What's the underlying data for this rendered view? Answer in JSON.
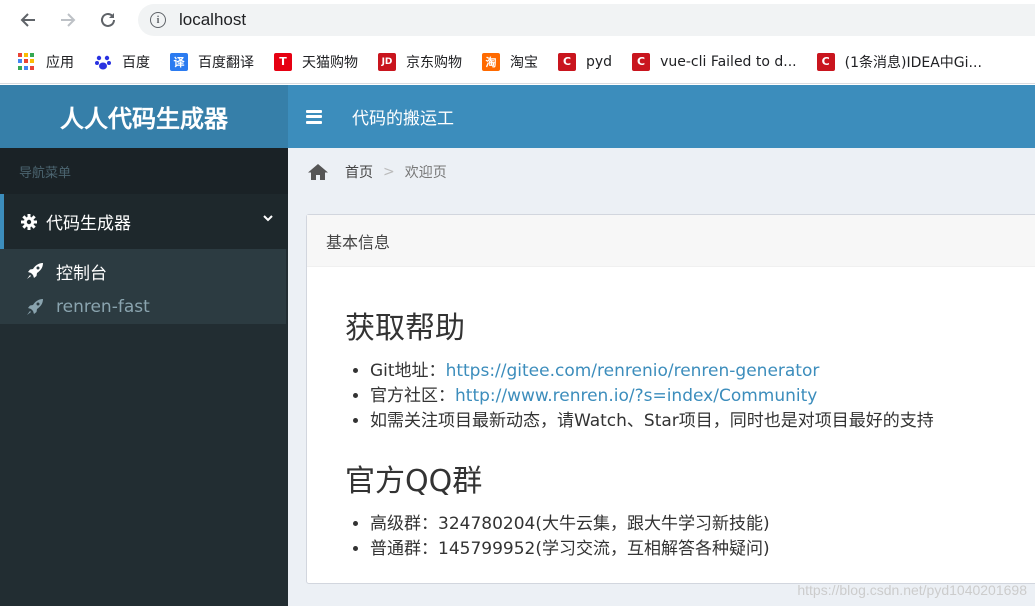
{
  "browser": {
    "url": "localhost",
    "bookmarks": [
      {
        "label": "应用",
        "icon": "apps-grid-icon"
      },
      {
        "label": "百度",
        "icon": "baidu-paw-icon",
        "color": "#2932e1"
      },
      {
        "label": "百度翻译",
        "icon": "translate-icon",
        "glyph": "译",
        "color": "#2b7bf0"
      },
      {
        "label": "天猫购物",
        "icon": "tmall-icon",
        "glyph": "T",
        "color": "#e60012"
      },
      {
        "label": "京东购物",
        "icon": "jd-icon",
        "glyph": "JD",
        "color": "#c9151e"
      },
      {
        "label": "淘宝",
        "icon": "taobao-icon",
        "glyph": "淘",
        "color": "#ff6a00"
      },
      {
        "label": "pyd",
        "icon": "csdn-icon",
        "glyph": "C",
        "color": "#c9151e"
      },
      {
        "label": "vue-cli Failed to d...",
        "icon": "csdn-icon",
        "glyph": "C",
        "color": "#c9151e"
      },
      {
        "label": "(1条消息)IDEA中Gi...",
        "icon": "csdn-icon",
        "glyph": "C",
        "color": "#c9151e"
      }
    ]
  },
  "app": {
    "logo": "人人代码生成器",
    "header_title": "代码的搬运工",
    "sidebar": {
      "header": "导航菜单",
      "group_label": "代码生成器",
      "items": [
        {
          "label": "控制台",
          "active": true
        },
        {
          "label": "renren-fast",
          "active": false
        }
      ]
    },
    "breadcrumb": {
      "home": "首页",
      "separator": ">",
      "current": "欢迎页"
    },
    "box": {
      "title": "基本信息",
      "help_heading": "获取帮助",
      "help_items": [
        {
          "label": "Git地址：",
          "link": "https://gitee.com/renrenio/renren-generator"
        },
        {
          "label": "官方社区：",
          "link": "http://www.renren.io/?s=index/Community"
        },
        {
          "label": "如需关注项目最新动态，请Watch、Star项目，同时也是对项目最好的支持",
          "link": ""
        }
      ],
      "qq_heading": "官方QQ群",
      "qq_items": [
        "高级群：324780204(大牛云集，跟大牛学习新技能)",
        "普通群：145799952(学习交流，互相解答各种疑问)"
      ]
    },
    "watermark": "https://blog.csdn.net/pyd1040201698"
  },
  "colors": {
    "brand": "#3c8dbc",
    "logo_bg": "#367fa9",
    "sidebar_bg": "#222d32"
  }
}
